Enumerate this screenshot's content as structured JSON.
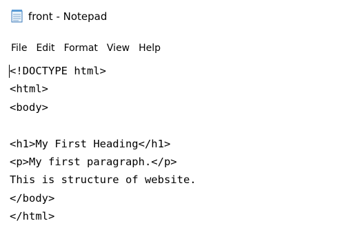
{
  "window": {
    "title": "front - Notepad",
    "icon": "notepad-icon"
  },
  "menu": {
    "items": [
      "File",
      "Edit",
      "Format",
      "View",
      "Help"
    ]
  },
  "editor": {
    "lines": [
      "<!DOCTYPE html>",
      "<html>",
      "<body>",
      "",
      "<h1>My First Heading</h1>",
      "<p>My first paragraph.</p>",
      "This is structure of website.",
      "</body>",
      "</html>"
    ]
  }
}
